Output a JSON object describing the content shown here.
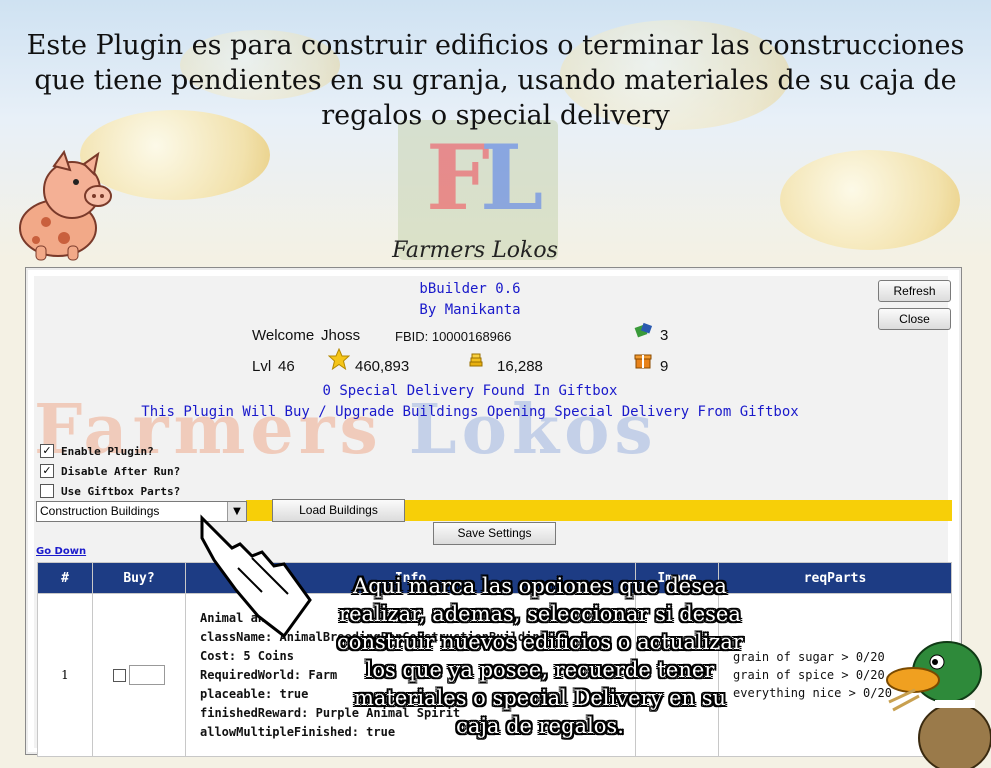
{
  "headline": "Este Plugin es para  construir edificios o terminar las  construcciones que tiene pendientes en su granja, usando  materiales de su caja de regalos o special delivery",
  "logo_text": "FL",
  "banner": "Farmers Lokos",
  "app": {
    "title": "bBuilder 0.6",
    "author": "By Manikanta",
    "welcome_label": "Welcome",
    "user_name": "Jhoss",
    "fbid_label": "FBID: 10000168966",
    "level_label": "Lvl",
    "level": "46",
    "xp": "460,893",
    "coins": "16,288",
    "fuel": "3",
    "gifts": "9",
    "special_delivery_status": "0 Special Delivery Found In Giftbox",
    "description": "This Plugin Will Buy / Upgrade Buildings Opening Special Delivery From Giftbox"
  },
  "buttons": {
    "refresh": "Refresh",
    "close": "Close",
    "load_buildings": "Load Buildings",
    "save_settings": "Save Settings"
  },
  "options": {
    "enable_plugin": {
      "label": "Enable Plugin?",
      "checked": true
    },
    "disable_after_run": {
      "label": "Disable After Run?",
      "checked": true
    },
    "use_giftbox_parts": {
      "label": "Use Giftbox Parts?",
      "checked": false
    }
  },
  "building_select": {
    "value": "Construction Buildings"
  },
  "go_down": "Go Down",
  "table": {
    "headers": [
      "#",
      "Buy?",
      "Info",
      "Image",
      "reqParts"
    ],
    "rows": [
      {
        "index": "1",
        "info": [
          "Animal  ani",
          "className: AnimalBreedingPenConstructionBuilding",
          "Cost: 5 Coins",
          "RequiredWorld: Farm",
          "placeable: true",
          "finishedReward: Purple Animal Spirit",
          "allowMultipleFinished: true"
        ],
        "parts": [
          "grain of sugar > 0/20",
          "grain of spice > 0/20",
          "everything nice > 0/20"
        ]
      }
    ]
  },
  "watermark": {
    "part1": "Farmers",
    "part2": "Lokos"
  },
  "overlay_text": "Aqui marca las opciones que desea realizar, ademas, seleccionar si desea construir nuevos edificios o actualizar los que ya posee, recuerde tener materiales o special Delivery en su caja de regalos."
}
